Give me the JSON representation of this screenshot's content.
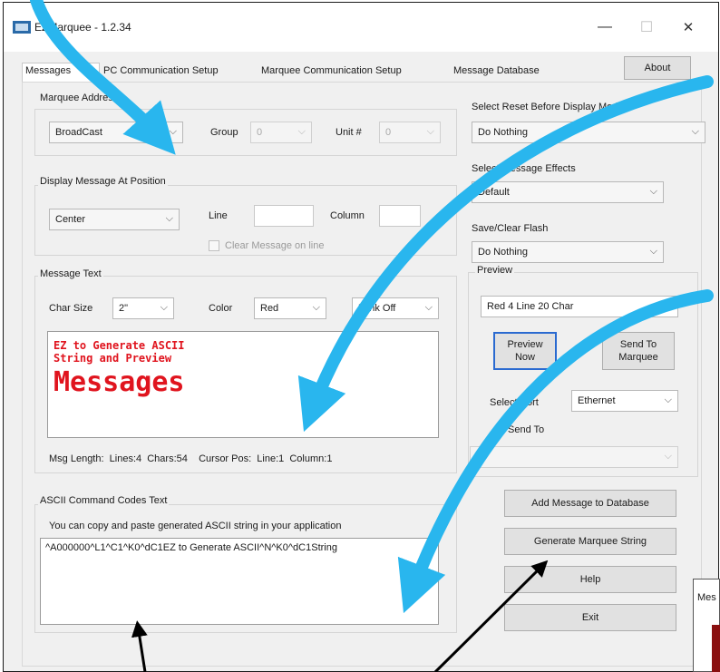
{
  "window": {
    "title": "EZMarquee - 1.2.34",
    "controls": {
      "minimize": "—",
      "maximize": "☐",
      "close": "✕"
    }
  },
  "tabs": [
    {
      "label": "Messages"
    },
    {
      "label": "PC Communication Setup"
    },
    {
      "label": "Marquee Communication Setup"
    },
    {
      "label": "Message Database"
    }
  ],
  "about_button": "About",
  "marquee_address": {
    "label": "Marquee Address",
    "address": "BroadCast",
    "group_label": "Group",
    "group_value": "0",
    "unit_label": "Unit #",
    "unit_value": "0"
  },
  "display_position": {
    "label": "Display Message At Position",
    "position": "Center",
    "line_label": "Line",
    "line_value": "",
    "column_label": "Column",
    "column_value": "",
    "clear_label": "Clear Message on line",
    "clear_checked": false
  },
  "message_text": {
    "label": "Message Text",
    "char_size_label": "Char Size",
    "char_size": "2\"",
    "color_label": "Color",
    "color": "Red",
    "blink": "Blink Off",
    "preview_small_lines": [
      "EZ to Generate ASCII",
      "String and Preview"
    ],
    "preview_big": "Messages",
    "led_color": "#e0141e",
    "status": "Msg Length:  Lines:4  Chars:54    Cursor Pos:  Line:1  Column:1"
  },
  "right": {
    "reset_label": "Select Reset Before Display Mode",
    "reset_value": "Do Nothing",
    "effects_label": "Select Message Effects",
    "effects_value": "Default",
    "flash_label": "Save/Clear Flash",
    "flash_value": "Do Nothing",
    "preview_label": "Preview",
    "preview_type": "Red 4 Line 20 Char",
    "preview_now": "Preview\nNow",
    "send_to_marquee": "Send To\nMarquee",
    "select_port_label": "Select Port",
    "port_value": "Ethernet",
    "send_to_label": "Send To",
    "send_to_value": ""
  },
  "ascii": {
    "label": "ASCII Command Codes Text",
    "hint": "You can copy and paste generated ASCII string in your application",
    "value": "^A000000^L1^C1^K0^dC1EZ to Generate ASCII^N^K0^dC1String"
  },
  "buttons": {
    "add_to_db": "Add Message to Database",
    "generate": "Generate Marquee String",
    "help": "Help",
    "exit": "Exit"
  },
  "side_window": {
    "title": "Mes"
  },
  "annotation_arrow_color": "#29b6ee"
}
